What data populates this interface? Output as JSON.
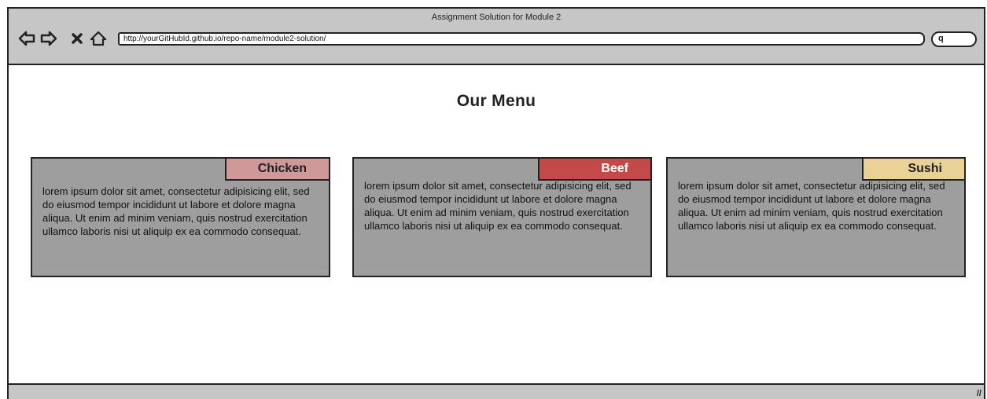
{
  "browser": {
    "window_title": "Assignment Solution for Module 2",
    "url": "http://yourGitHubId.github.io/repo-name/module2-solution/",
    "nav_icons": [
      "back-arrow-icon",
      "forward-arrow-icon",
      "stop-icon",
      "home-icon"
    ],
    "search_glyph": "q"
  },
  "page": {
    "heading": "Our Menu",
    "cards": [
      {
        "title": "Chicken",
        "tag_color": "#d09999",
        "tag_text_color": "#222222",
        "text": "lorem ipsum dolor sit amet, consectetur adipisicing elit, sed do eiusmod tempor incididunt ut labore et dolore magna aliqua. Ut enim ad minim veniam, quis nostrud exercitation ullamco laboris nisi ut aliquip ex ea commodo consequat."
      },
      {
        "title": "Beef",
        "tag_color": "#c44a4a",
        "tag_text_color": "#ffffff",
        "text": "lorem ipsum dolor sit amet, consectetur adipisicing elit, sed do eiusmod tempor incididunt ut labore et dolore magna aliqua. Ut enim ad minim veniam, quis nostrud exercitation ullamco laboris nisi ut aliquip ex ea commodo consequat."
      },
      {
        "title": "Sushi",
        "tag_color": "#ead196",
        "tag_text_color": "#222222",
        "text": "lorem ipsum dolor sit amet, consectetur adipisicing elit, sed do eiusmod tempor incididunt ut labore et dolore magna aliqua. Ut enim ad minim veniam, quis nostrud exercitation ullamco laboris nisi ut aliquip ex ea commodo consequat."
      }
    ]
  },
  "colors": {
    "chrome": "#c6c6c6",
    "card_body": "#9e9e9e",
    "border": "#222222"
  }
}
